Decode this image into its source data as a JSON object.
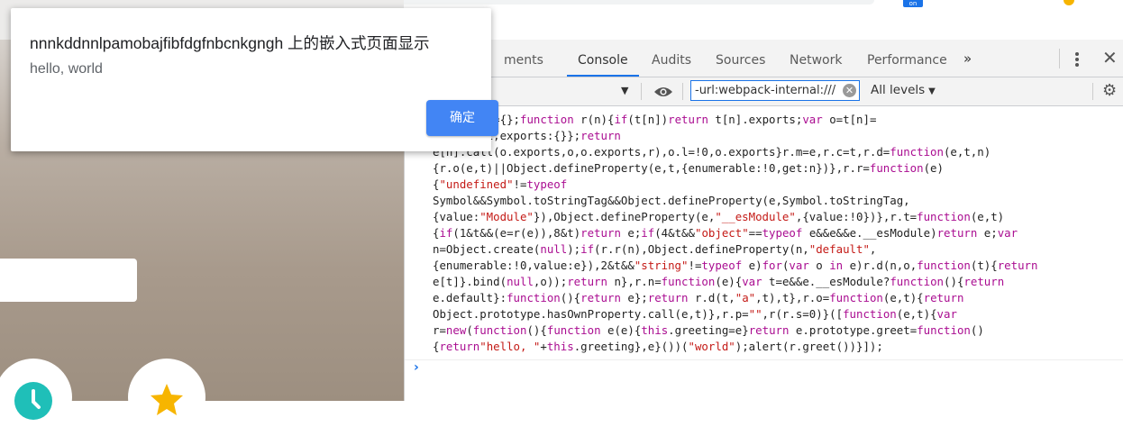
{
  "dialog": {
    "title": "nnnkddnnlpamobajfibfdgfnbcnkgngh 上的嵌入式页面显示",
    "message": "hello, world",
    "ok_label": "确定"
  },
  "browser": {
    "extension_badge": "on"
  },
  "devtools": {
    "tabs": [
      {
        "label": "ments",
        "active": false
      },
      {
        "label": "Console",
        "active": true
      },
      {
        "label": "Audits",
        "active": false
      },
      {
        "label": "Sources",
        "active": false
      },
      {
        "label": "Network",
        "active": false
      },
      {
        "label": "Performance",
        "active": false
      }
    ],
    "more_tabs_icon": "»",
    "toolbar": {
      "filter_value": "-url:webpack-internal:///",
      "levels_label": "All levels"
    },
    "console": {
      "prompt_symbol": "›"
    }
  },
  "colors": {
    "accent": "#1a73e8",
    "dialog_button": "#4285f4",
    "keyword": "#aa0d91",
    "string": "#c41a16",
    "fab_teal": "#1fbfb8",
    "fab_star": "#f7b500"
  }
}
